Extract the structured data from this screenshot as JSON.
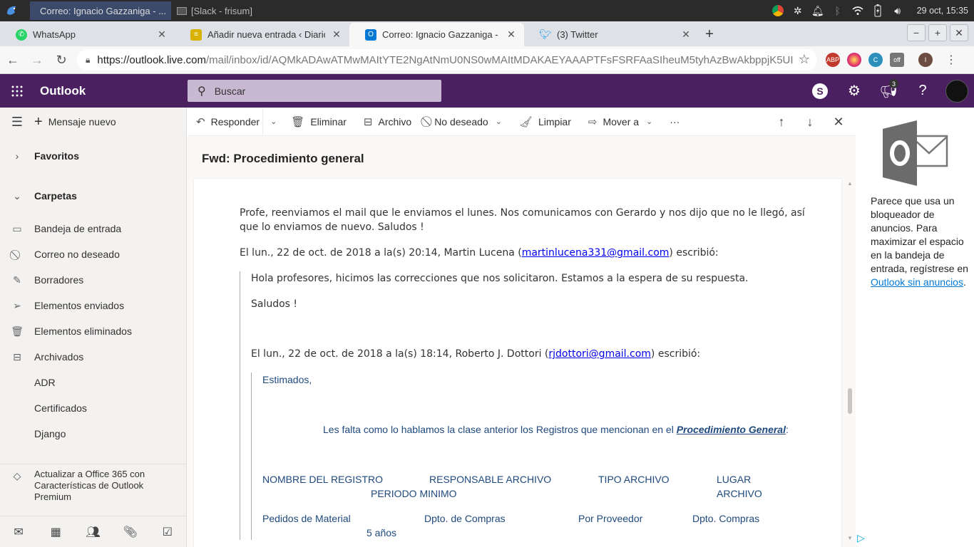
{
  "os": {
    "tasks": [
      {
        "label": "Correo: Ignacio Gazzaniga - ...",
        "active": true
      },
      {
        "label": "[Slack - frisum]",
        "active": false
      }
    ],
    "clock": "29 oct, 15:35"
  },
  "browser": {
    "tabs": [
      {
        "label": "WhatsApp",
        "favicon": "whatsapp-icon",
        "color": "#25d366",
        "active": false
      },
      {
        "label": "Añadir nueva entrada ‹ Diario X",
        "favicon": "diario-icon",
        "color": "#d9b200",
        "active": false
      },
      {
        "label": "Correo: Ignacio Gazzaniga - Ou",
        "favicon": "outlook-icon",
        "color": "#0078d4",
        "active": true
      },
      {
        "label": "(3) Twitter",
        "favicon": "twitter-icon",
        "color": "#1da1f2",
        "active": false
      }
    ],
    "url_host": "https://outlook.live.com",
    "url_path": "/mail/inbox/id/AQMkADAwATMwMAItYTE2NgAtNmU0NS0wMAItMDAKAEYAAAPTFsFSRFAaSIheuM5tyhAzBwAkbppjK5UI...",
    "extensions": [
      {
        "name": "adblock-icon",
        "color": "#c0392b",
        "badge": "6"
      },
      {
        "name": "instagram-icon",
        "color": "#e1306c"
      },
      {
        "name": "cr-icon",
        "color": "#2c8ebb"
      },
      {
        "name": "toggle-icon",
        "color": "#777",
        "badge": "off"
      },
      {
        "name": "profile-icon",
        "color": "#6d4c41",
        "badge": "I"
      }
    ]
  },
  "outlook": {
    "brand": "Outlook",
    "search_placeholder": "Buscar",
    "header_badge": "3"
  },
  "nav": {
    "new_message": "Mensaje nuevo",
    "favorites": "Favoritos",
    "folders_header": "Carpetas",
    "folders": [
      {
        "label": "Bandeja de entrada",
        "icon": "inbox-icon"
      },
      {
        "label": "Correo no deseado",
        "icon": "blocked-icon"
      },
      {
        "label": "Borradores",
        "icon": "pencil-icon"
      },
      {
        "label": "Elementos enviados",
        "icon": "send-icon"
      },
      {
        "label": "Elementos eliminados",
        "icon": "trash-icon"
      },
      {
        "label": "Archivados",
        "icon": "archive-icon"
      },
      {
        "label": "ADR",
        "icon": ""
      },
      {
        "label": "Certificados",
        "icon": ""
      },
      {
        "label": "Django",
        "icon": ""
      }
    ],
    "promo": "Actualizar a Office 365 con Características de Outlook Premium"
  },
  "commands": {
    "reply": "Responder",
    "delete": "Eliminar",
    "archive": "Archivo",
    "junk": "No deseado",
    "sweep": "Limpiar",
    "move": "Mover a",
    "more": "···"
  },
  "message": {
    "subject": "Fwd: Procedimiento general",
    "intro": "Profe, reenviamos el mail que le enviamos el lunes. Nos comunicamos con Gerardo y nos dijo que no le llegó, así que lo enviamos de nuevo. Saludos !",
    "q1_head_pre": "El lun., 22 de oct. de 2018 a la(s) 20:14, Martin Lucena (",
    "q1_email": "martinlucena331@gmail.com",
    "q1_head_post": ") escribió:",
    "q1_body1": "Hola profesores, hicimos las correcciones que nos solicitaron. Estamos a la espera de su respuesta.",
    "q1_body2": "Saludos !",
    "q2_head_pre": "El lun., 22 de oct. de 2018 a la(s) 18:14, Roberto J. Dottori (",
    "q2_email": "rjdottori@gmail.com",
    "q2_head_post": ") escribió:",
    "q2_greeting": "Estimados,",
    "q2_line_pre": "Les falta como lo hablamos la clase anterior los Registros que mencionan en el ",
    "q2_line_link": "Procedimiento General",
    "q2_line_post": ":",
    "table_headers": [
      "NOMBRE DEL REGISTRO",
      "RESPONSABLE ARCHIVO",
      "TIPO ARCHIVO",
      "LUGAR ARCHIVO",
      "PERIODO MINIMO"
    ],
    "table_row1": [
      "Pedidos de Material",
      "Dpto. de Compras",
      "Por Proveedor",
      "Dpto. Compras",
      "5 años"
    ]
  },
  "ad": {
    "text": "Parece que usa un bloqueador de anuncios. Para maximizar el espacio en la bandeja de entrada, regístrese en ",
    "link": "Outlook sin anuncios",
    "after": "."
  }
}
